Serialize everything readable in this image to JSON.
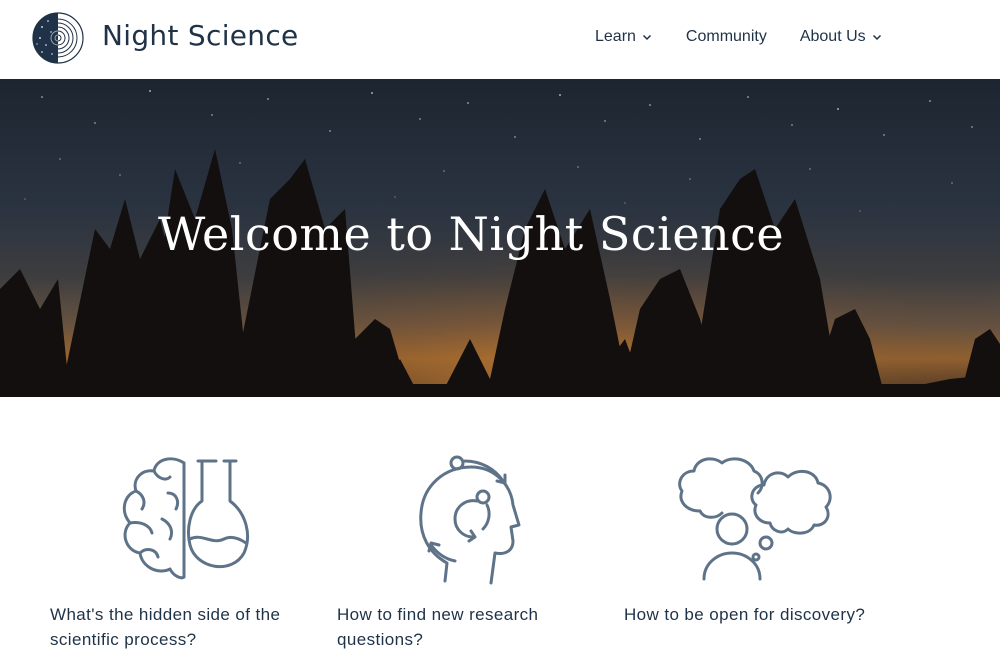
{
  "header": {
    "brand": "Night Science",
    "logo_icon": "concentric-circles-logo-icon",
    "nav": [
      {
        "label": "Learn",
        "has_dropdown": true
      },
      {
        "label": "Community",
        "has_dropdown": false
      },
      {
        "label": "About Us",
        "has_dropdown": true
      }
    ]
  },
  "hero": {
    "title": "Welcome to Night Science",
    "image": "starry-night-forest-silhouette"
  },
  "features": [
    {
      "icon": "brain-flask-icon",
      "text": "What's the hidden side of the scientific process?"
    },
    {
      "icon": "head-cycle-icon",
      "text": "How to find new research questions?"
    },
    {
      "icon": "person-thought-clouds-icon",
      "text": "How to be open for discovery?"
    }
  ],
  "colors": {
    "text": "#1f3247",
    "icon_stroke": "#5f7388",
    "hero_sky": "#1d2530",
    "hero_glow": "#a0672c"
  }
}
